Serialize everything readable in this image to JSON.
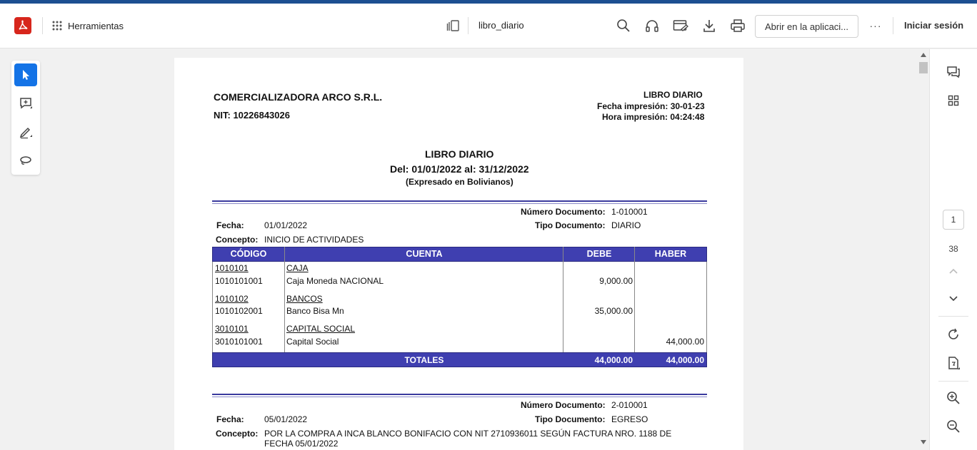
{
  "toolbar": {
    "tools_label": "Herramientas",
    "filename": "libro_diario",
    "open_app_label": "Abrir en la aplicaci...",
    "more_label": "···",
    "signin_label": "Iniciar sesión"
  },
  "icons": {
    "logo": "acrobat-logo",
    "grid": "apps-grid-icon",
    "pages": "pages-icon",
    "search": "search-icon",
    "audio": "headphones-icon",
    "fill_sign": "fill-sign-icon",
    "download": "download-icon",
    "print": "print-icon"
  },
  "right_panel": {
    "current_page": "1",
    "total_pages": "38"
  },
  "document": {
    "company": "COMERCIALIZADORA ARCO S.R.L.",
    "nit": "NIT: 10226843026",
    "header_right_title": "LIBRO DIARIO",
    "fecha_impresion": "Fecha impresión: 30-01-23",
    "hora_impresion": "Hora impresión: 04:24:48",
    "title": "LIBRO DIARIO",
    "period": "Del: 01/01/2022 al: 31/12/2022",
    "currency": "(Expresado en Bolivianos)",
    "entry1": {
      "numero_label": "Número Documento:",
      "numero": "1-010001",
      "fecha_label": "Fecha:",
      "fecha": "01/01/2022",
      "tipo_label": "Tipo Documento:",
      "tipo": "DIARIO",
      "concepto_label": "Concepto:",
      "concepto": "INICIO DE ACTIVIDADES",
      "headers": {
        "codigo": "CÓDIGO",
        "cuenta": "CUENTA",
        "debe": "DEBE",
        "haber": "HABER"
      },
      "rows": [
        {
          "codigo": "1010101",
          "cuenta": "CAJA",
          "debe": "",
          "haber": ""
        },
        {
          "codigo": "1010101001",
          "cuenta": "Caja Moneda NACIONAL",
          "debe": "9,000.00",
          "haber": ""
        },
        {
          "codigo": "1010102",
          "cuenta": "BANCOS",
          "debe": "",
          "haber": ""
        },
        {
          "codigo": "1010102001",
          "cuenta": "Banco Bisa Mn",
          "debe": "35,000.00",
          "haber": ""
        },
        {
          "codigo": "3010101",
          "cuenta": "CAPITAL SOCIAL",
          "debe": "",
          "haber": ""
        },
        {
          "codigo": "3010101001",
          "cuenta": "Capital Social",
          "debe": "",
          "haber": "44,000.00"
        }
      ],
      "totales_label": "TOTALES",
      "total_debe": "44,000.00",
      "total_haber": "44,000.00"
    },
    "entry2": {
      "numero_label": "Número Documento:",
      "numero": "2-010001",
      "fecha_label": "Fecha:",
      "fecha": "05/01/2022",
      "tipo_label": "Tipo Documento:",
      "tipo": "EGRESO",
      "concepto_label": "Concepto:",
      "concepto_line1": "POR LA COMPRA A INCA BLANCO BONIFACIO CON NIT 2710936011 SEGÚN FACTURA NRO. 1188 DE",
      "concepto_line2": "FECHA 05/01/2022"
    }
  }
}
